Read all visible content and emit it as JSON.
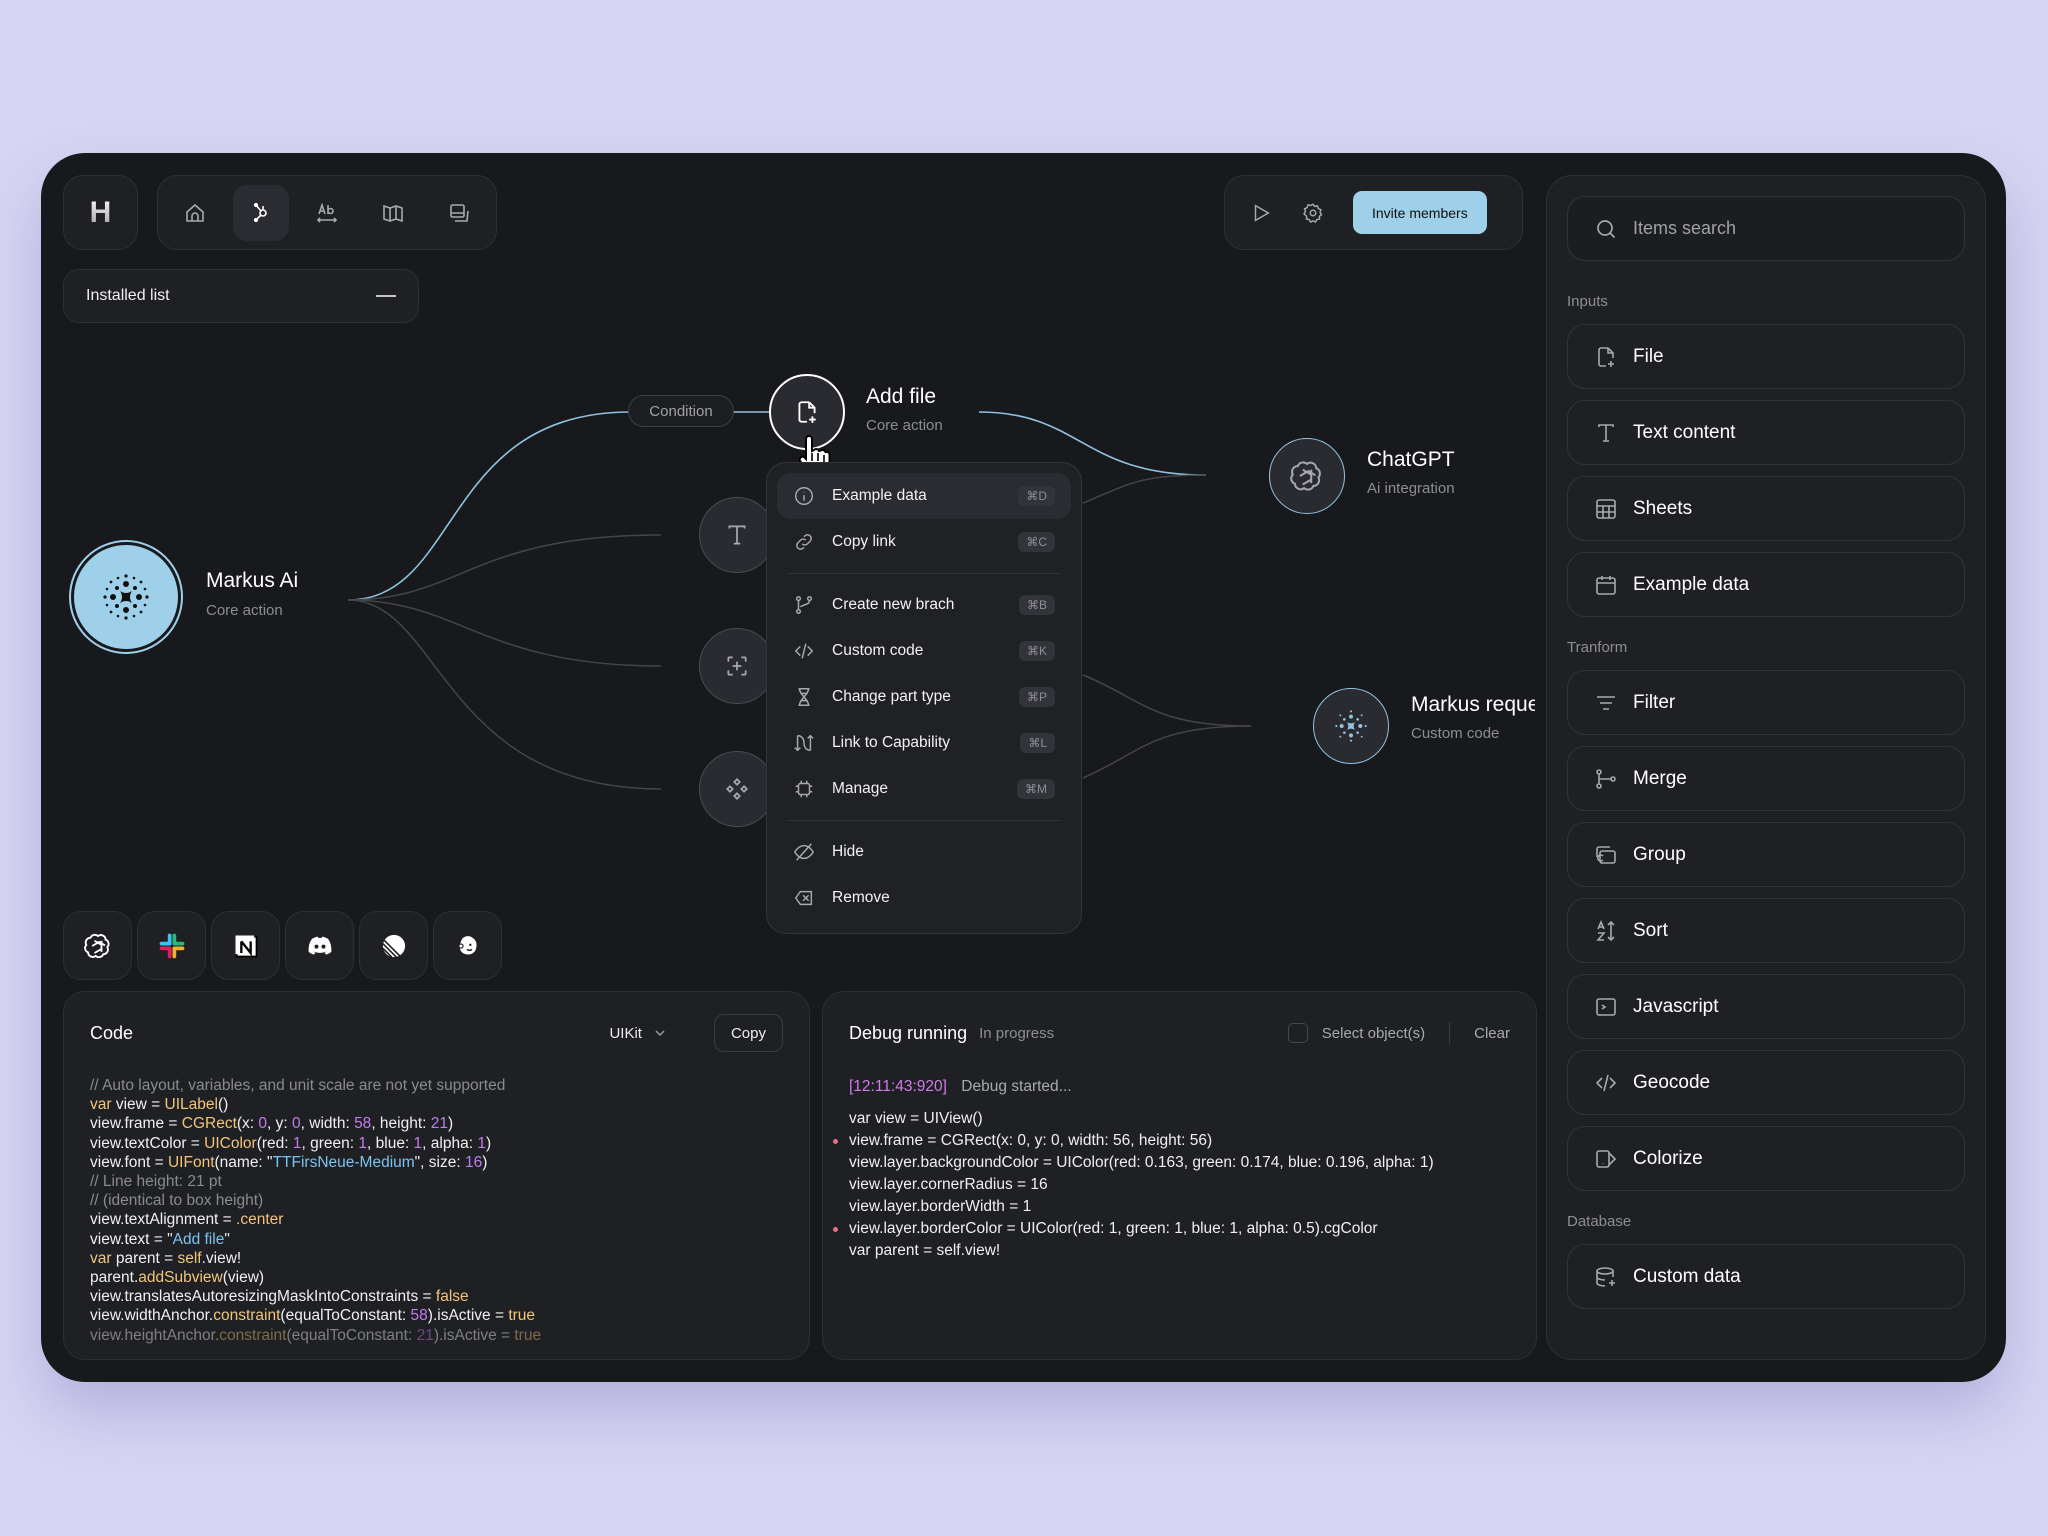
{
  "app": {
    "logo_letter": "H",
    "nav": [
      {
        "name": "home",
        "active": false
      },
      {
        "name": "workflow",
        "active": true
      },
      {
        "name": "text-format",
        "active": false
      },
      {
        "name": "book",
        "active": false
      },
      {
        "name": "copy",
        "active": false
      }
    ],
    "installed_list_label": "Installed list",
    "invite_label": "Invite members",
    "accent_color": "#9fd0ea"
  },
  "canvas": {
    "condition_label": "Condition",
    "nodes": {
      "markus_ai": {
        "title": "Markus Ai",
        "subtitle": "Core action"
      },
      "add_file": {
        "title": "Add file",
        "subtitle": "Core action"
      },
      "chatgpt": {
        "title": "ChatGPT",
        "subtitle": "Ai integration"
      },
      "markus_request": {
        "title": "Markus reque",
        "subtitle": "Custom code"
      }
    }
  },
  "context_menu": {
    "group1": [
      {
        "label": "Example data",
        "shortcut": "⌘D",
        "icon": "info-icon"
      },
      {
        "label": "Copy link",
        "shortcut": "⌘C",
        "icon": "link-icon"
      }
    ],
    "group2": [
      {
        "label": "Create new brach",
        "shortcut": "⌘B",
        "icon": "branch-icon"
      },
      {
        "label": "Custom code",
        "shortcut": "⌘K",
        "icon": "code-icon"
      },
      {
        "label": "Change part type",
        "shortcut": "⌘P",
        "icon": "dna-icon"
      },
      {
        "label": "Link to Capability",
        "shortcut": "⌘L",
        "icon": "arrows-icon"
      },
      {
        "label": "Manage",
        "shortcut": "⌘M",
        "icon": "chip-icon"
      }
    ],
    "group3": [
      {
        "label": "Hide",
        "icon": "eye-off-icon"
      },
      {
        "label": "Remove",
        "icon": "delete-icon"
      }
    ]
  },
  "integrations": [
    "openai",
    "slack",
    "notion",
    "discord",
    "linear",
    "mailchimp"
  ],
  "code_panel": {
    "title": "Code",
    "framework": "UIKit",
    "copy_label": "Copy",
    "lines": [
      "// Auto layout, variables, and unit scale are not yet supported",
      "var view = UILabel()",
      "view.frame = CGRect(x: 0, y: 0, width: 58, height: 21)",
      "view.textColor = UIColor(red: 1, green: 1, blue: 1, alpha: 1)",
      "view.font = UIFont(name: \"TTFirsNeue-Medium\", size: 16)",
      "// Line height: 21 pt",
      "// (identical to box height)",
      "view.textAlignment = .center",
      "view.text = \"Add file\"",
      "var parent = self.view!",
      "parent.addSubview(view)",
      "view.translatesAutoresizingMaskIntoConstraints = false",
      "view.widthAnchor.constraint(equalToConstant: 58).isActive = true",
      "view.heightAnchor.constraint(equalToConstant: 21).isActive = true"
    ]
  },
  "debug_panel": {
    "title": "Debug running",
    "status": "In progress",
    "select_label": "Select object(s)",
    "clear_label": "Clear",
    "timestamp": "[12:11:43:920]",
    "start_msg": "Debug started...",
    "lines": [
      {
        "text": "var view = UIView()",
        "marked": false
      },
      {
        "text": "view.frame = CGRect(x: 0, y: 0, width: 56, height: 56)",
        "marked": true
      },
      {
        "text": "view.layer.backgroundColor = UIColor(red: 0.163, green: 0.174, blue: 0.196, alpha: 1)",
        "marked": false
      },
      {
        "text": "view.layer.cornerRadius = 16",
        "marked": false
      },
      {
        "text": "view.layer.borderWidth = 1",
        "marked": false
      },
      {
        "text": "view.layer.borderColor = UIColor(red: 1, green: 1, blue: 1, alpha: 0.5).cgColor",
        "marked": true
      },
      {
        "text": "var parent = self.view!",
        "marked": false
      }
    ]
  },
  "sidebar": {
    "search_placeholder": "Items search",
    "sections": [
      {
        "title": "Inputs",
        "items": [
          "File",
          "Text content",
          "Sheets",
          "Example data"
        ]
      },
      {
        "title": "Tranform",
        "items": [
          "Filter",
          "Merge",
          "Group",
          "Sort",
          "Javascript",
          "Geocode",
          "Colorize"
        ]
      },
      {
        "title": "Database",
        "items": [
          "Custom data"
        ]
      }
    ]
  }
}
